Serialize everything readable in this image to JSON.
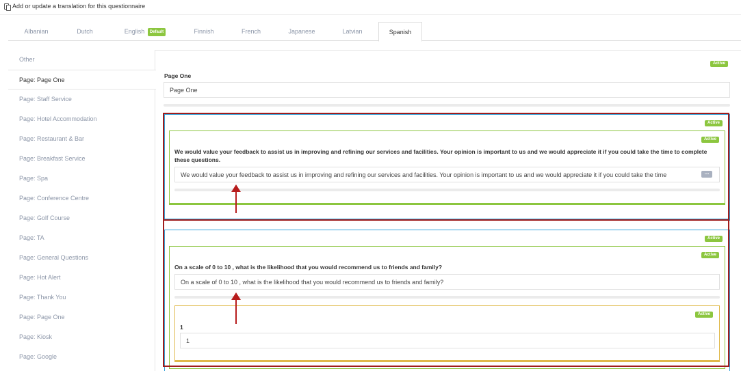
{
  "header": {
    "title": "Add or update a translation for this questionnaire",
    "icon": "copy-icon"
  },
  "tabs": [
    {
      "label": "Albanian"
    },
    {
      "label": "Dutch"
    },
    {
      "label": "English",
      "badge": "Default"
    },
    {
      "label": "Finnish"
    },
    {
      "label": "French"
    },
    {
      "label": "Japanese"
    },
    {
      "label": "Latvian"
    },
    {
      "label": "Spanish",
      "active": true
    }
  ],
  "sidebar": {
    "items": [
      {
        "label": "Other"
      },
      {
        "label": "Page: Page One",
        "active": true
      },
      {
        "label": "Page: Staff Service"
      },
      {
        "label": "Page: Hotel Accommodation"
      },
      {
        "label": "Page: Restaurant & Bar"
      },
      {
        "label": "Page: Breakfast Service"
      },
      {
        "label": "Page: Spa"
      },
      {
        "label": "Page: Conference Centre"
      },
      {
        "label": "Page: Golf Course"
      },
      {
        "label": "Page: TA"
      },
      {
        "label": "Page: General Questions"
      },
      {
        "label": "Page: Hot Alert"
      },
      {
        "label": "Page: Thank You"
      },
      {
        "label": "Page: Page One"
      },
      {
        "label": "Page: Kiosk"
      },
      {
        "label": "Page: Google"
      }
    ]
  },
  "status_label": "Active",
  "page": {
    "label": "Page One",
    "value": "Page One"
  },
  "question1": {
    "label": "We would value your feedback to assist us in improving and refining our services and facilities. Your opinion is important to us and we would appreciate it if you could take the time to complete these questions.",
    "value": "We would value your feedback to assist us in improving and refining our services and facilities. Your opinion is important to us and we would appreciate it if you could take the time"
  },
  "question2": {
    "label": "On a scale of 0 to 10 , what is the likelihood that you would recommend us to friends and family?",
    "value": "On a scale of 0 to 10 , what is the likelihood that you would recommend us to friends and family?"
  },
  "option1": {
    "label": "1",
    "value": "1"
  },
  "colors": {
    "active_green": "#8cc63f",
    "annotation_red": "#a01c1c",
    "section_blue": "#1f9bd6",
    "option_gold": "#e0b94a",
    "muted_text": "#8c96a8"
  }
}
